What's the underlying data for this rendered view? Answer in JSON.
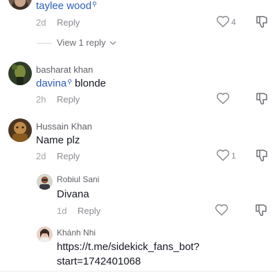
{
  "comments": [
    {
      "name": "taylee wood",
      "time": "2d",
      "reply_label": "Reply",
      "likes": "4",
      "view_replies": "View 1 reply"
    },
    {
      "name": "basharat khan",
      "mention": "davina",
      "text": "blonde",
      "time": "2h",
      "reply_label": "Reply"
    },
    {
      "name": "Hussain Khan",
      "text": "Name plz",
      "time": "2d",
      "reply_label": "Reply",
      "likes": "1"
    }
  ],
  "replies": [
    {
      "name": "Robiul Sani",
      "text": "Divana",
      "time": "1d",
      "reply_label": "Reply"
    },
    {
      "name": "Khánh Nhi",
      "text_line1": "https://t.me/sidekick_fans_bot?",
      "text_line2": "start=1742401068"
    }
  ],
  "colors": {
    "mention": "#2b5db9",
    "text": "#161823",
    "muted": "#8a8b91"
  },
  "icons": [
    "heart-outline-icon",
    "dislike-icon",
    "chevron-down-icon",
    "search-mention-icon"
  ]
}
